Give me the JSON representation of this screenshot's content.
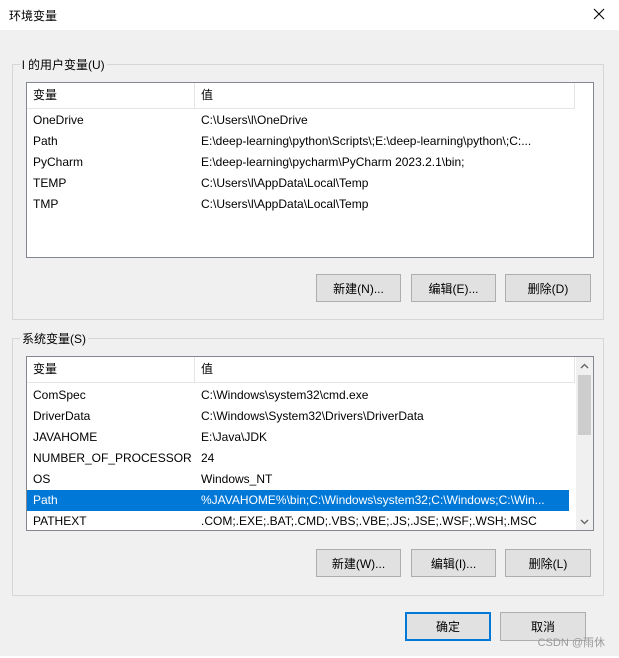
{
  "window": {
    "title": "环境变量",
    "close_icon": "close-icon"
  },
  "user_vars": {
    "group_label": "l 的用户变量(U)",
    "headers": {
      "name": "变量",
      "value": "值"
    },
    "rows": [
      {
        "name": "OneDrive",
        "value": "C:\\Users\\l\\OneDrive"
      },
      {
        "name": "Path",
        "value": "E:\\deep-learning\\python\\Scripts\\;E:\\deep-learning\\python\\;C:..."
      },
      {
        "name": "PyCharm",
        "value": "E:\\deep-learning\\pycharm\\PyCharm 2023.2.1\\bin;"
      },
      {
        "name": "TEMP",
        "value": "C:\\Users\\l\\AppData\\Local\\Temp"
      },
      {
        "name": "TMP",
        "value": "C:\\Users\\l\\AppData\\Local\\Temp"
      }
    ],
    "buttons": {
      "new": "新建(N)...",
      "edit": "编辑(E)...",
      "delete": "删除(D)"
    }
  },
  "system_vars": {
    "group_label": "系统变量(S)",
    "headers": {
      "name": "变量",
      "value": "值"
    },
    "rows": [
      {
        "name": "ComSpec",
        "value": "C:\\Windows\\system32\\cmd.exe"
      },
      {
        "name": "DriverData",
        "value": "C:\\Windows\\System32\\Drivers\\DriverData"
      },
      {
        "name": "JAVAHOME",
        "value": "E:\\Java\\JDK"
      },
      {
        "name": "NUMBER_OF_PROCESSORS",
        "value": "24"
      },
      {
        "name": "OS",
        "value": "Windows_NT"
      },
      {
        "name": "Path",
        "value": "%JAVAHOME%\\bin;C:\\Windows\\system32;C:\\Windows;C:\\Win...",
        "selected": true
      },
      {
        "name": "PATHEXT",
        "value": ".COM;.EXE;.BAT;.CMD;.VBS;.VBE;.JS;.JSE;.WSF;.WSH;.MSC"
      }
    ],
    "buttons": {
      "new": "新建(W)...",
      "edit": "编辑(I)...",
      "delete": "删除(L)"
    }
  },
  "footer": {
    "ok": "确定",
    "cancel": "取消"
  },
  "watermark": "CSDN @雨休",
  "colors": {
    "selection": "#0078d7",
    "dialog_bg": "#f0f0f0",
    "default_button_border": "#0078d7"
  }
}
